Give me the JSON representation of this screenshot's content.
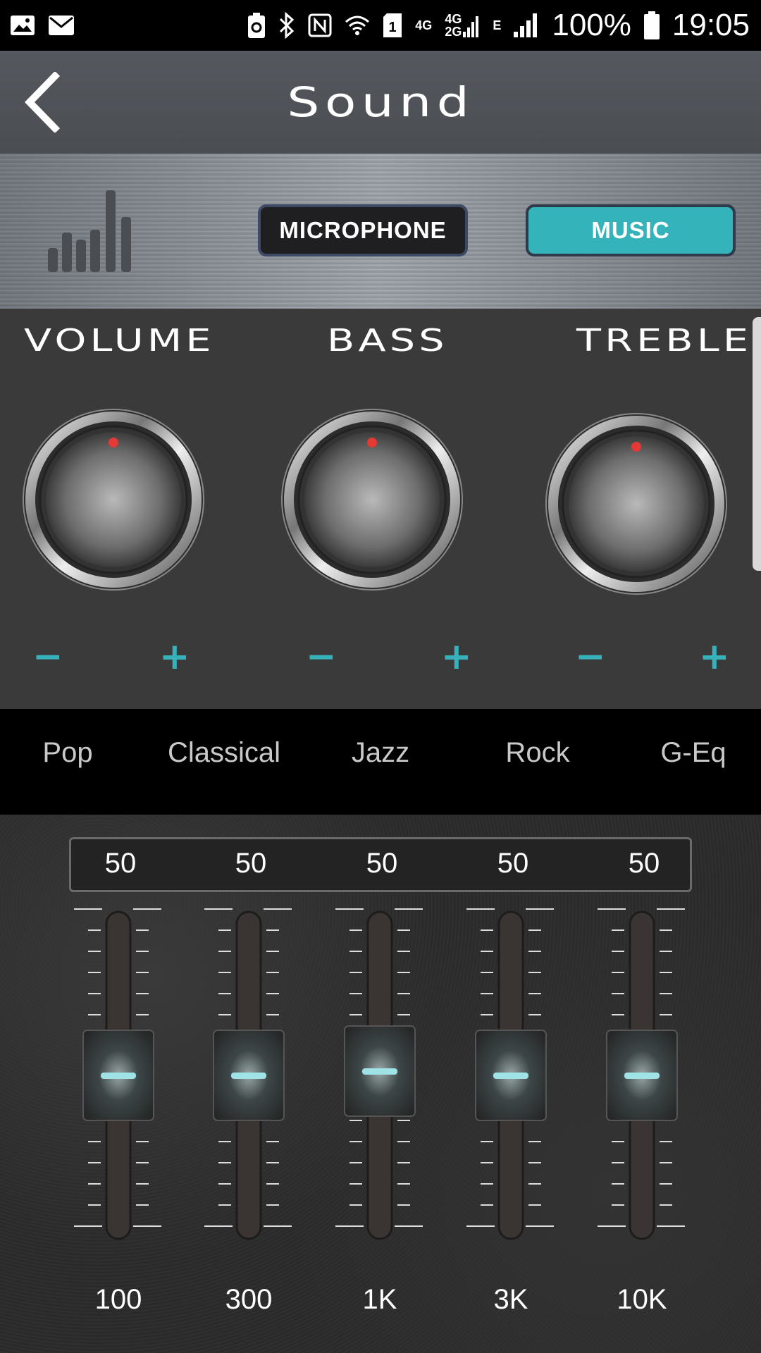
{
  "status_bar": {
    "left_icons": [
      "image-icon",
      "mail-icon"
    ],
    "right_icons": [
      "battery-saver-icon",
      "bluetooth-icon",
      "nfc-icon",
      "wifi-icon",
      "sim1-icon"
    ],
    "net_4g": "4G",
    "net_4g2g_top": "4G",
    "net_4g2g_bottom": "2G",
    "net_e": "E",
    "battery": "100%",
    "time": "19:05"
  },
  "header": {
    "title": "Sound",
    "back_icon": "chevron-left-icon"
  },
  "modes": {
    "microphone": "MICROPHONE",
    "music": "MUSIC",
    "active": "music",
    "active_color": "#35b3ba"
  },
  "knobs": [
    {
      "label": "VOLUME",
      "minus": "−",
      "plus": "+"
    },
    {
      "label": "BASS",
      "minus": "−",
      "plus": "+"
    },
    {
      "label": "TREBLE",
      "minus": "−",
      "plus": "+"
    }
  ],
  "presets": [
    "Pop",
    "Classical",
    "Jazz",
    "Rock",
    "G-Eq"
  ],
  "equalizer": {
    "bands": [
      {
        "value": "50",
        "freq": "100",
        "level": 0.5
      },
      {
        "value": "50",
        "freq": "300",
        "level": 0.5
      },
      {
        "value": "50",
        "freq": "1K",
        "level": 0.5
      },
      {
        "value": "50",
        "freq": "3K",
        "level": 0.5
      },
      {
        "value": "50",
        "freq": "10K",
        "level": 0.5
      }
    ]
  },
  "colors": {
    "accent": "#36b2bb",
    "knob_dot": "#e53935"
  }
}
